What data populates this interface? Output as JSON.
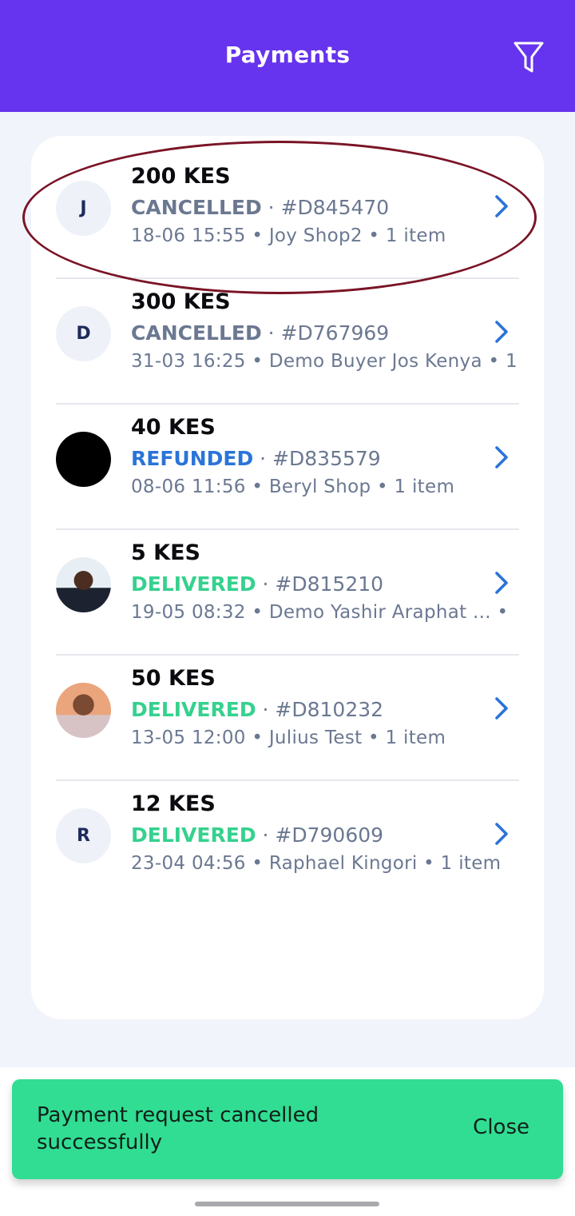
{
  "header": {
    "title": "Payments",
    "filter_icon": "filter-icon"
  },
  "payments": [
    {
      "avatar_text": "J",
      "amount": "200 KES",
      "status": "CANCELLED",
      "order_id": "#D845470",
      "meta": "18-06 15:55 • Joy Shop2 • 1 item"
    },
    {
      "avatar_text": "D",
      "amount": "300 KES",
      "status": "CANCELLED",
      "order_id": "#D767969",
      "meta": "31-03 16:25 • Demo Buyer Jos Kenya • 1"
    },
    {
      "avatar_text": "",
      "amount": "40 KES",
      "status": "REFUNDED",
      "order_id": "#D835579",
      "meta": "08-06 11:56 • Beryl Shop • 1 item"
    },
    {
      "avatar_text": "",
      "amount": "5 KES",
      "status": "DELIVERED",
      "order_id": "#D815210",
      "meta": "19-05 08:32 • Demo Yashir Araphat ... •"
    },
    {
      "avatar_text": "",
      "amount": "50 KES",
      "status": "DELIVERED",
      "order_id": "#D810232",
      "meta": "13-05 12:00 • Julius Test • 1 item"
    },
    {
      "avatar_text": "R",
      "amount": "12 KES",
      "status": "DELIVERED",
      "order_id": "#D790609",
      "meta": "23-04 04:56 • Raphael Kingori • 1 item"
    }
  ],
  "separator": " · ",
  "toast": {
    "message": "Payment request cancelled successfully",
    "close_label": "Close"
  },
  "colors": {
    "header": "#6633EE",
    "cancelled": "#6B7891",
    "refunded": "#2A74D8",
    "delivered": "#35D18E",
    "toast": "#31DD92",
    "chevron": "#2A74D8",
    "highlight": "#7A1426"
  }
}
